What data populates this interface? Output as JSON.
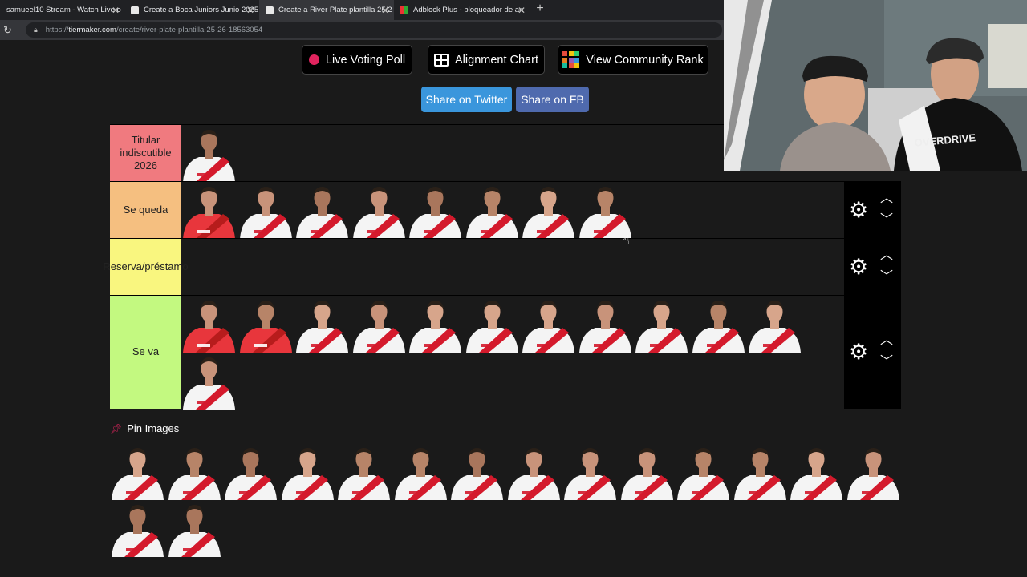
{
  "browser": {
    "tabs": [
      {
        "title": "samueel10 Stream - Watch Live o",
        "active": false
      },
      {
        "title": "Create a Boca Juniors Junio 2025",
        "active": false
      },
      {
        "title": "Create a River Plate plantilla 25/2",
        "active": true
      },
      {
        "title": "Adblock Plus - bloqueador de an",
        "active": false
      }
    ],
    "url_prefix": "https://",
    "url_host": "tiermaker.com",
    "url_path": "/create/river-plate-plantilla-25-26-18563054"
  },
  "buttons": {
    "live_voting": "Live Voting Poll",
    "alignment": "Alignment Chart",
    "community_rank": "View Community Rank",
    "share_twitter": "Share on Twitter",
    "share_fb": "Share on FB"
  },
  "colors": {
    "tier1": "#f07a7f",
    "tier2": "#f5bf80",
    "tier3": "#f9f67f",
    "tier4": "#c3f980",
    "twitter": "#3a96dc",
    "facebook": "#4f6aae",
    "river_red": "#d41a2c"
  },
  "tiers": [
    {
      "label": "Titular indiscutible 2026",
      "count": 1
    },
    {
      "label": "Se queda",
      "count": 8
    },
    {
      "label": "Reserva/préstamo",
      "count": 0
    },
    {
      "label": "Se va",
      "count": 12
    }
  ],
  "pin": {
    "title": "Pin Images",
    "count": 16
  },
  "icons": {
    "settings": "gear-icon",
    "move_up": "chevron-up-icon",
    "move_down": "chevron-down-icon",
    "pin": "pin-icon"
  }
}
